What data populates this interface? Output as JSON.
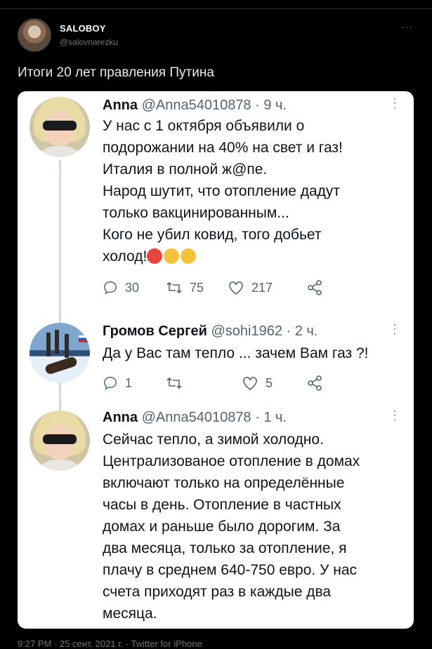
{
  "post": {
    "display_name": "SALOBOY",
    "handle": "@salovnarezku",
    "text": "Итоги 20 лет правления Путина",
    "more_icon": "more-icon",
    "footer": "9:27 PM · 25 сент. 2021 г. · Twitter for iPhone"
  },
  "screenshot": {
    "replies": [
      {
        "name": "Anna",
        "meta": "@Anna54010878 · 9 ч.",
        "lines": [
          "У нас с 1 октября объявили о",
          "подорожании на 40% на свет и газ!",
          "Италия в полной ж@пе.",
          "Народ шутит, что отопление дадут",
          "только вакцинированным...",
          "Кого не убил ковид, того добьет",
          "холод!"
        ],
        "emoji": [
          "angry-face-emoji",
          "weary-face-emoji",
          "persevering-face-emoji"
        ],
        "actions": {
          "reply": "30",
          "retweet": "75",
          "like": "217"
        }
      },
      {
        "name": "Громов Сергей",
        "meta": "@sohi1962 · 2 ч.",
        "lines": [
          "Да у Вас там тепло ... зачем Вам газ ?!"
        ],
        "actions": {
          "reply": "1",
          "retweet": "",
          "like": "5"
        }
      },
      {
        "name": "Anna",
        "meta": "@Anna54010878 · 1 ч.",
        "lines": [
          "Сейчас тепло, а зимой холодно.",
          "Централизованое отопление в домах",
          "включают только на определённые",
          "часы в день. Отопление в частных",
          "домах и раньше было дорогим. За",
          "два месяца, только за отопление, я",
          "плачу в среднем 640-750 евро. У нас",
          "счета приходят раз в каждые два",
          "месяца."
        ]
      }
    ]
  }
}
